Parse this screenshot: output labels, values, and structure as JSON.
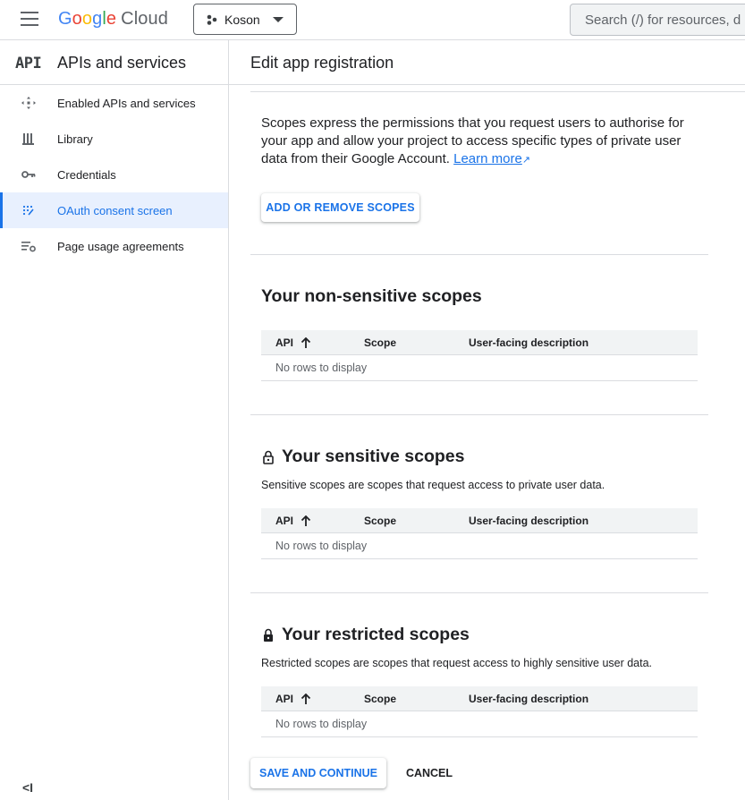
{
  "header": {
    "logo": {
      "g": "G",
      "o1": "o",
      "o2": "o",
      "g2": "g",
      "l": "l",
      "e": "e",
      "cloud": "Cloud"
    },
    "project_name": "Koson",
    "search_placeholder": "Search (/) for resources, d"
  },
  "sidebar": {
    "badge": "API",
    "title": "APIs and services",
    "items": [
      {
        "label": "Enabled APIs and services",
        "icon": "enabled-apis-icon",
        "active": false
      },
      {
        "label": "Library",
        "icon": "library-icon",
        "active": false
      },
      {
        "label": "Credentials",
        "icon": "key-icon",
        "active": false
      },
      {
        "label": "OAuth consent screen",
        "icon": "oauth-icon",
        "active": true
      },
      {
        "label": "Page usage agreements",
        "icon": "settings-list-icon",
        "active": false
      }
    ],
    "collapse_glyph": "<I"
  },
  "main": {
    "title": "Edit app registration",
    "intro_text": "Scopes express the permissions that you request users to authorise for your app and allow your project to access specific types of private user data from their Google Account.",
    "learn_more": "Learn more",
    "add_scopes_button": "ADD OR REMOVE SCOPES",
    "sections": [
      {
        "title": "Your non-sensitive scopes",
        "description": "",
        "lock": "none"
      },
      {
        "title": "Your sensitive scopes",
        "description": "Sensitive scopes are scopes that request access to private user data.",
        "lock": "open"
      },
      {
        "title": "Your restricted scopes",
        "description": "Restricted scopes are scopes that request access to highly sensitive user data.",
        "lock": "closed"
      }
    ],
    "table": {
      "columns": [
        "API",
        "Scope",
        "User-facing description"
      ],
      "empty_text": "No rows to display"
    },
    "save_button": "SAVE AND CONTINUE",
    "cancel_button": "CANCEL"
  },
  "colors": {
    "accent": "#1a73e8",
    "active_bg": "#e8f0fe",
    "border": "#dadce0"
  }
}
